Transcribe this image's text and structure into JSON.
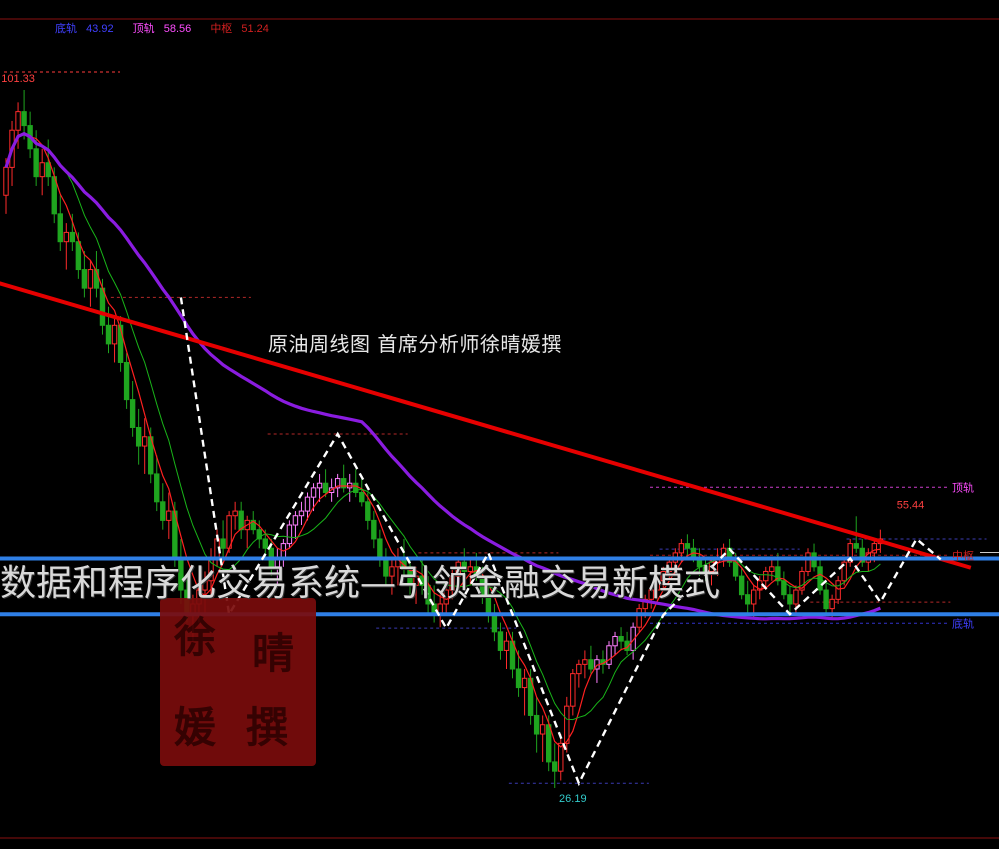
{
  "legend": [
    {
      "name": "底轨",
      "value": "43.92",
      "color": "#4040ff",
      "valueColor": "#4040ff"
    },
    {
      "name": "顶轨",
      "value": "58.56",
      "color": "#ff4dff",
      "valueColor": "#ff4dff"
    },
    {
      "name": "中枢",
      "value": "51.24",
      "color": "#d02020",
      "valueColor": "#d02020"
    }
  ],
  "title": "原油周线图   首席分析师徐晴媛撰",
  "banner": "数据和程序化交易系统—引领金融交易新模式",
  "stamp": [
    "徐",
    "晴",
    "媛",
    "撰"
  ],
  "right_labels": {
    "top_band": "顶轨",
    "mid_band": "中枢",
    "bottom_band": "底轨"
  },
  "colors": {
    "background": "#000000",
    "up_candle": "#ff2b2b",
    "down_candle": "#1fa51f",
    "pink_candle": "#ff7fff",
    "ma_fast": "#ff2020",
    "ma_slow": "#19b519",
    "ma_long": "#8a1ce0",
    "trendline": "#e60000",
    "channel": "#2f7fe6",
    "zigzag": "#ffffff"
  },
  "chart_data": {
    "type": "candlestick",
    "instrument": "原油",
    "period": "周线",
    "price_labels": [
      {
        "label": "101.33",
        "price": 101.33,
        "index": 2
      },
      {
        "label": "55.44",
        "price": 55.44,
        "index": 150
      },
      {
        "label": "26.19",
        "price": 26.19,
        "index": 94
      }
    ],
    "bands": {
      "bottom": 43.92,
      "top": 58.56,
      "middle": 51.24
    },
    "channel": {
      "upper": 50.9,
      "lower": 44.9
    },
    "trendline": [
      {
        "index": -2,
        "price": 80.7
      },
      {
        "index": 160,
        "price": 49.9
      }
    ],
    "zigzag": [
      {
        "index": 29,
        "price": 79.0
      },
      {
        "index": 37,
        "price": 44.9
      },
      {
        "index": 55,
        "price": 64.3
      },
      {
        "index": 73,
        "price": 43.4
      },
      {
        "index": 80,
        "price": 51.5
      },
      {
        "index": 95,
        "price": 26.7
      },
      {
        "index": 109,
        "price": 44.8
      },
      {
        "index": 120,
        "price": 51.9
      },
      {
        "index": 130,
        "price": 44.9
      },
      {
        "index": 140,
        "price": 50.9
      },
      {
        "index": 145,
        "price": 46.2
      },
      {
        "index": 151,
        "price": 53.0
      },
      {
        "index": 155,
        "price": 50.8
      }
    ],
    "ohlc": [
      [
        90,
        94,
        88,
        93
      ],
      [
        93,
        98,
        91,
        97
      ],
      [
        97,
        100,
        95,
        99
      ],
      [
        99,
        101.33,
        96,
        97.5
      ],
      [
        97.5,
        99,
        94,
        95
      ],
      [
        95,
        97,
        91,
        92
      ],
      [
        92,
        95,
        90,
        93.5
      ],
      [
        93.5,
        96,
        91,
        92
      ],
      [
        92,
        93,
        87,
        88
      ],
      [
        88,
        90,
        84,
        85
      ],
      [
        85,
        87,
        82,
        86
      ],
      [
        86,
        88,
        84,
        85
      ],
      [
        85,
        86,
        81,
        82
      ],
      [
        82,
        84,
        79,
        80
      ],
      [
        80,
        83,
        78,
        82
      ],
      [
        82,
        84,
        79,
        80
      ],
      [
        80,
        81,
        75,
        76
      ],
      [
        76,
        78,
        73,
        74
      ],
      [
        74,
        77,
        72,
        76
      ],
      [
        76,
        77,
        71,
        72
      ],
      [
        72,
        73,
        67,
        68
      ],
      [
        68,
        70,
        64,
        65
      ],
      [
        65,
        67,
        61,
        63
      ],
      [
        63,
        66,
        60,
        64
      ],
      [
        64,
        65,
        59,
        60
      ],
      [
        60,
        62,
        56,
        57
      ],
      [
        57,
        59,
        54,
        55
      ],
      [
        55,
        58,
        53,
        56
      ],
      [
        56,
        57,
        50,
        51
      ],
      [
        51,
        53,
        46,
        47.5
      ],
      [
        47.5,
        49,
        44,
        45
      ],
      [
        45,
        47,
        42,
        46
      ],
      [
        46,
        48,
        44,
        47.5
      ],
      [
        47.5,
        49.5,
        45,
        48.5
      ],
      [
        48.5,
        52,
        47,
        51
      ],
      [
        51,
        54,
        50,
        53
      ],
      [
        53,
        55,
        51,
        52
      ],
      [
        52,
        56,
        51.5,
        55.5
      ],
      [
        55.5,
        57,
        54,
        56
      ],
      [
        56,
        57,
        53,
        54
      ],
      [
        54,
        55.5,
        52,
        55
      ],
      [
        55,
        56,
        53.5,
        54
      ],
      [
        54,
        55,
        52,
        53
      ],
      [
        53,
        54,
        51,
        52
      ],
      [
        52,
        53,
        49,
        50
      ],
      [
        50,
        52,
        48,
        51
      ],
      [
        51,
        53,
        50,
        52.5
      ],
      [
        52.5,
        55,
        52,
        54.5
      ],
      [
        54.5,
        56,
        53,
        55.5
      ],
      [
        55.5,
        57,
        54.5,
        56
      ],
      [
        56,
        58,
        55,
        57.5
      ],
      [
        57.5,
        59,
        56,
        58.5
      ],
      [
        58.5,
        60,
        57,
        59
      ],
      [
        59,
        60.5,
        57.5,
        58
      ],
      [
        58,
        59.5,
        57,
        58.5
      ],
      [
        58.5,
        60,
        57.5,
        59.5
      ],
      [
        59.5,
        61,
        58,
        58.5
      ],
      [
        58.5,
        60,
        57,
        59
      ],
      [
        59,
        60.5,
        57.5,
        58
      ],
      [
        58,
        59.5,
        56.5,
        57
      ],
      [
        57,
        58,
        54,
        55
      ],
      [
        55,
        56,
        52,
        53
      ],
      [
        53,
        54,
        50,
        51
      ],
      [
        51,
        52,
        48,
        49
      ],
      [
        49,
        51,
        47,
        50
      ],
      [
        50,
        52,
        48,
        51
      ],
      [
        51,
        53,
        49,
        50
      ],
      [
        50,
        51,
        47,
        48
      ],
      [
        48,
        50,
        46,
        49
      ],
      [
        49,
        51,
        47,
        48
      ],
      [
        48,
        49,
        45,
        46
      ],
      [
        46,
        48,
        44,
        45
      ],
      [
        45,
        47,
        43.5,
        46
      ],
      [
        46,
        48,
        45,
        47.5
      ],
      [
        47.5,
        50,
        46.5,
        49
      ],
      [
        49,
        51,
        48,
        50.5
      ],
      [
        50.5,
        52,
        49,
        49.5
      ],
      [
        49.5,
        51,
        48,
        50
      ],
      [
        50,
        51.5,
        48.5,
        49
      ],
      [
        49,
        50,
        46,
        47
      ],
      [
        47,
        48,
        44,
        45
      ],
      [
        45,
        46,
        42,
        43
      ],
      [
        43,
        44,
        40,
        41
      ],
      [
        41,
        43,
        39,
        42
      ],
      [
        42,
        43,
        38,
        39
      ],
      [
        39,
        41,
        36,
        37
      ],
      [
        37,
        39,
        34,
        38
      ],
      [
        38,
        39,
        33,
        34
      ],
      [
        34,
        36,
        30,
        32
      ],
      [
        32,
        34,
        29,
        33
      ],
      [
        33,
        34,
        28,
        29
      ],
      [
        29,
        31,
        26.19,
        28
      ],
      [
        28,
        32,
        27,
        31
      ],
      [
        31,
        36,
        30,
        35
      ],
      [
        35,
        39,
        34,
        38.5
      ],
      [
        38.5,
        40,
        37,
        39.5
      ],
      [
        39.5,
        41,
        38,
        40
      ],
      [
        40,
        41.5,
        38.5,
        39
      ],
      [
        39,
        40.5,
        37.5,
        40
      ],
      [
        40,
        41,
        38.5,
        39.5
      ],
      [
        39.5,
        42,
        39,
        41.5
      ],
      [
        41.5,
        43,
        40.5,
        42.5
      ],
      [
        42.5,
        43.5,
        41,
        42
      ],
      [
        42,
        43,
        40.5,
        41
      ],
      [
        41,
        44,
        40,
        43.5
      ],
      [
        43.5,
        46,
        43,
        45.5
      ],
      [
        45.5,
        47,
        44.5,
        46.5
      ],
      [
        46.5,
        48,
        45.5,
        47.5
      ],
      [
        47.5,
        49,
        46.5,
        48.5
      ],
      [
        48.5,
        50,
        47.5,
        49.5
      ],
      [
        49.5,
        51,
        48.5,
        50.5
      ],
      [
        50.5,
        52,
        49.5,
        51.5
      ],
      [
        51.5,
        53,
        50.5,
        52.5
      ],
      [
        52.5,
        53.5,
        51,
        52
      ],
      [
        52,
        53,
        50.5,
        51
      ],
      [
        51,
        52,
        49,
        50
      ],
      [
        50,
        51,
        48.5,
        49.5
      ],
      [
        49.5,
        51,
        48,
        50.5
      ],
      [
        50.5,
        52,
        49,
        51
      ],
      [
        51,
        52.5,
        50,
        52
      ],
      [
        52,
        53,
        50,
        50.5
      ],
      [
        50.5,
        51.5,
        48.5,
        49
      ],
      [
        49,
        50,
        46.5,
        47
      ],
      [
        47,
        48.5,
        45,
        46
      ],
      [
        46,
        48,
        44.5,
        47.5
      ],
      [
        47.5,
        49,
        46.5,
        48.5
      ],
      [
        48.5,
        50,
        47.5,
        49.5
      ],
      [
        49.5,
        51,
        48.5,
        50
      ],
      [
        50,
        51.5,
        48,
        48.5
      ],
      [
        48.5,
        49.5,
        46.5,
        47
      ],
      [
        47,
        48,
        45,
        46
      ],
      [
        46,
        48,
        45,
        47.5
      ],
      [
        47.5,
        50,
        47,
        49.5
      ],
      [
        49.5,
        52,
        49,
        51.5
      ],
      [
        51.5,
        52.5,
        49.5,
        50
      ],
      [
        50,
        51,
        47,
        47.5
      ],
      [
        47.5,
        48.5,
        45,
        45.5
      ],
      [
        45.5,
        47,
        44.5,
        46.5
      ],
      [
        46.5,
        49,
        46,
        48.5
      ],
      [
        48.5,
        51,
        48,
        50.5
      ],
      [
        50.5,
        53,
        50,
        52.5
      ],
      [
        52.5,
        55.44,
        51.5,
        52
      ],
      [
        52,
        53,
        50,
        50.5
      ],
      [
        50.5,
        52,
        49.5,
        51.5
      ],
      [
        51.5,
        53,
        50.5,
        52.5
      ],
      [
        52.5,
        54,
        51.5,
        53
      ]
    ]
  }
}
